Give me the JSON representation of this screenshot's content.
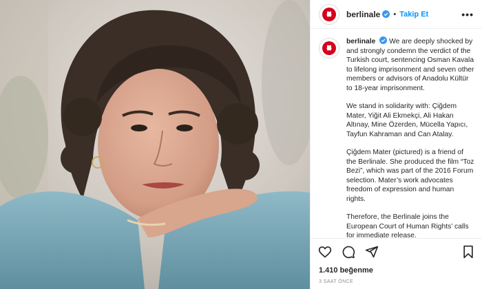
{
  "post": {
    "username": "berlinale",
    "follow_label": "Takip Et",
    "dot": "•",
    "more_label": "•••",
    "likes": "1.410 beğenme",
    "time_ago": "3 SAAT ÖNCE"
  },
  "caption": {
    "username": "berlinale",
    "paragraphs": [
      "We are deeply shocked by and strongly condemn the verdict of the Turkish court, sentencing Osman Kavala to lifelong imprisonment and seven other members or advisors of Anadolu Kültür to 18-year imprisonment.",
      "We stand in solidarity with: Çiğdem Mater, Yiğit Ali Ekmekçi, Ali Hakan Altınay, Mine Özerden, Mücella Yapıcı, Tayfun Kahraman and Can Atalay.",
      "Çiğdem Mater (pictured) is a friend of the Berlinale. She produced the film “Toz Bezi”, which was part of the 2016 Forum selection. Mater’s work advocates freedom of expression and human rights.",
      "Therefore, the Berlinale joins the European Court of Human Rights’ calls for immediate release."
    ]
  },
  "icons": {
    "like": "heart-icon",
    "comment": "comment-icon",
    "share": "share-icon",
    "save": "bookmark-icon",
    "verified": "verified-badge-icon",
    "brand_avatar": "berlinale-bear-icon"
  },
  "colors": {
    "follow_blue": "#0095f6",
    "verified_blue": "#3897f0",
    "brand_red": "#d6001c",
    "muted_text": "#8e8e8e"
  }
}
